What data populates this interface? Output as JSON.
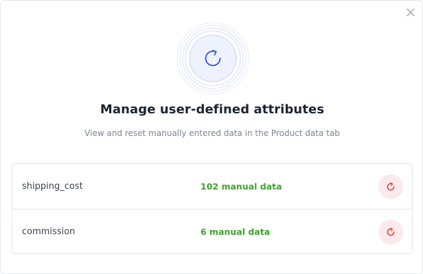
{
  "dialog": {
    "title": "Manage user-defined attributes",
    "subtitle": "View and reset manually entered data in the Product data tab",
    "close_icon": "close-icon",
    "hero_icon": "refresh-icon"
  },
  "attributes": [
    {
      "name": "shipping_cost",
      "count_label": "102 manual data",
      "action_icon": "reset-icon"
    },
    {
      "name": "commission",
      "count_label": "6 manual data",
      "action_icon": "reset-icon"
    }
  ],
  "colors": {
    "accent": "#3b63e0",
    "hero_fill": "#eef2fd",
    "count_text": "#3fa32b",
    "reset_icon": "#e0454a",
    "reset_bg": "#fbeaea"
  }
}
